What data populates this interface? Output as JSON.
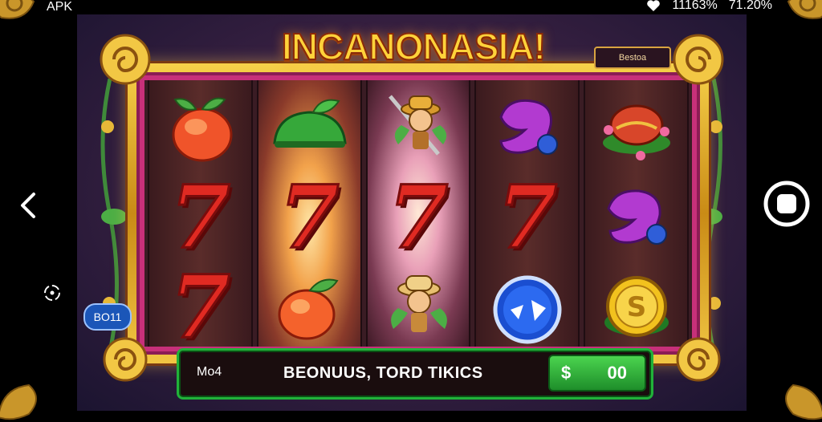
{
  "status_bar": {
    "app_label": "APK",
    "signal_text": "11163%",
    "battery_text": "71.20%",
    "icons": [
      "heart-icon"
    ]
  },
  "game": {
    "title": "INCANONASIA!",
    "top_badge": "Bestoa",
    "side_pill": "BO11",
    "bottom_bar": {
      "label": "Mo4",
      "message": "BEONUUS, TORD TIKICS",
      "currency": "$",
      "amount": "00"
    },
    "reels": [
      [
        "peach",
        "7",
        "7"
      ],
      [
        "green-lime",
        "7",
        "peach"
      ],
      [
        "explorer",
        "7",
        "explorer"
      ],
      [
        "purple-fruit",
        "7",
        "blue-bonus-orb"
      ],
      [
        "strawberry-bowl",
        "purple-fruit",
        "gold-coin"
      ]
    ],
    "seven_symbol": "7"
  },
  "nav": {
    "icons": [
      "back-icon",
      "rotate-icon",
      "home-icon"
    ]
  },
  "colors": {
    "frame_gold": "#f2c744",
    "frame_pink": "#c7307a",
    "seven_red": "#e02a22",
    "bottom_green": "#21b23a",
    "pill_blue": "#1b56b8"
  }
}
